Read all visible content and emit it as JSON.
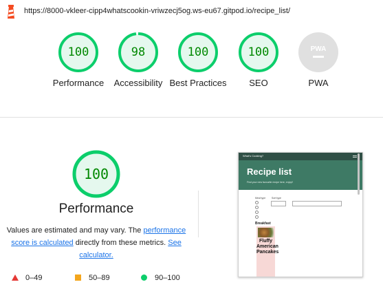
{
  "url": "https://8000-vkleer-cipp4whatscookin-vriwzecj5og.ws-eu67.gitpod.io/recipe_list/",
  "gauges": [
    {
      "label": "Performance",
      "score": "100",
      "fraction": 1.0
    },
    {
      "label": "Accessibility",
      "score": "98",
      "fraction": 0.98
    },
    {
      "label": "Best Practices",
      "score": "100",
      "fraction": 1.0
    },
    {
      "label": "SEO",
      "score": "100",
      "fraction": 1.0
    },
    {
      "label": "PWA",
      "score": "PWA"
    }
  ],
  "performance": {
    "score": "100",
    "title": "Performance",
    "desc_prefix": "Values are estimated and may vary. The ",
    "link1": "performance score is calculated",
    "desc_middle": " directly from these metrics. ",
    "link2": "See calculator."
  },
  "legend": [
    {
      "range": "0–49",
      "color": "#e53935"
    },
    {
      "range": "50–89",
      "color": "#f4a61d"
    },
    {
      "range": "90–100",
      "color": "#0cce6b"
    }
  ],
  "screenshot": {
    "brand": "What's Cooking?",
    "heading": "Recipe list",
    "subheading": "Find your new favourite recipe here, enjoy!!",
    "filter_label": "Meal type",
    "filter_label2": "Sort type",
    "section": "Breakfast",
    "card_title": "Fluffy American Pancakes"
  },
  "colors": {
    "pass": "#0cce6b",
    "pass_text": "#008800",
    "pass_bg": "#e5f8ee",
    "link": "#1a73e8"
  }
}
